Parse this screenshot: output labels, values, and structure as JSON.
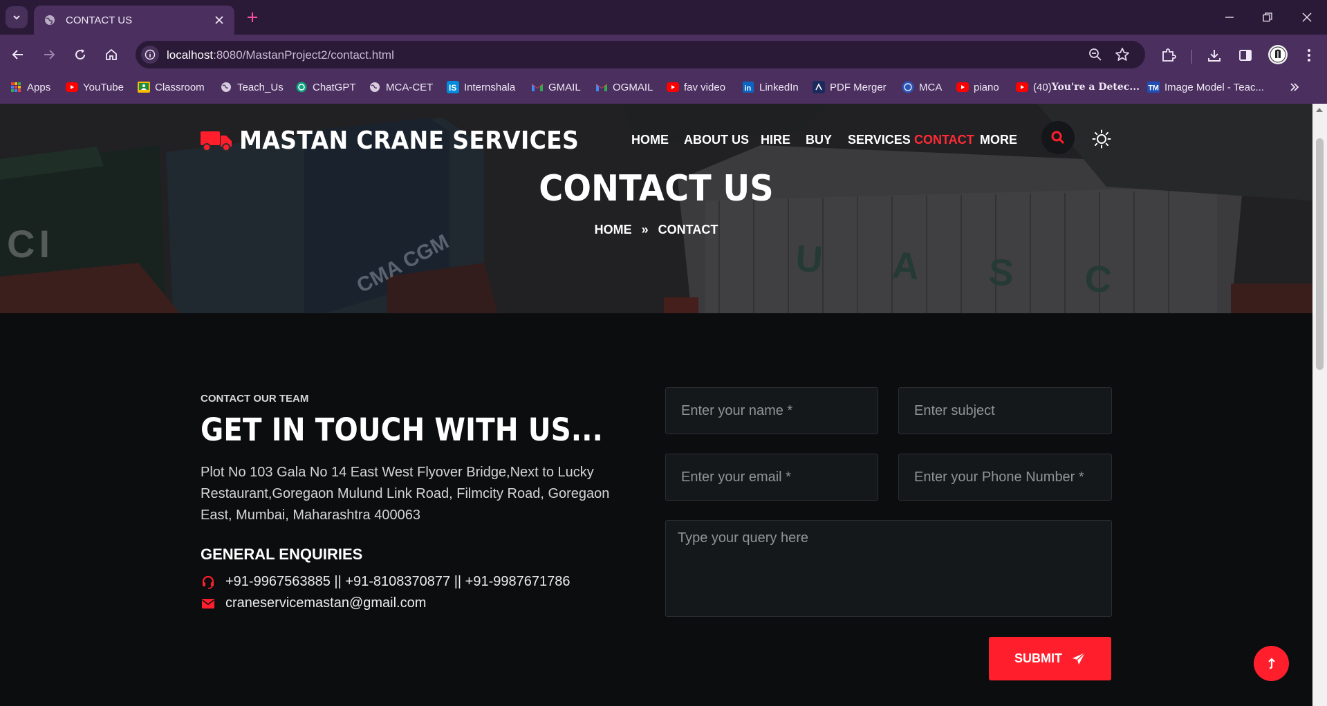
{
  "browser": {
    "tab_title": "CONTACT US",
    "url_host": "localhost",
    "url_rest": ":8080/MastanProject2/contact.html",
    "bookmarks": [
      {
        "label": "Apps",
        "icon": "apps-grid-icon"
      },
      {
        "label": "YouTube",
        "icon": "youtube-icon"
      },
      {
        "label": "Classroom",
        "icon": "classroom-icon"
      },
      {
        "label": "Teach_Us",
        "icon": "globe-icon"
      },
      {
        "label": "ChatGPT",
        "icon": "chatgpt-icon"
      },
      {
        "label": "MCA-CET",
        "icon": "globe-icon"
      },
      {
        "label": "Internshala",
        "icon": "internshala-icon"
      },
      {
        "label": "GMAIL",
        "icon": "gmail-icon"
      },
      {
        "label": "OGMAIL",
        "icon": "gmail-icon"
      },
      {
        "label": "fav video",
        "icon": "youtube-icon"
      },
      {
        "label": "LinkedIn",
        "icon": "linkedin-icon"
      },
      {
        "label": "PDF Merger",
        "icon": "pdf-merger-icon"
      },
      {
        "label": "MCA",
        "icon": "mca-icon"
      },
      {
        "label": "piano",
        "icon": "youtube-icon"
      },
      {
        "label_prefix": "(40) ",
        "label_bold": "You're a Detec...",
        "icon": "youtube-icon"
      },
      {
        "label": "Image Model - Teac...",
        "icon": "tm-icon"
      }
    ]
  },
  "site": {
    "brand": "MASTAN CRANE SERVICES",
    "nav": [
      "HOME",
      "ABOUT US",
      "HIRE",
      "BUY",
      "SERVICES",
      "CONTACT",
      "MORE"
    ],
    "active_nav": "CONTACT",
    "hero_title": "CONTACT US",
    "breadcrumb": {
      "home": "HOME",
      "sep": "»",
      "current": "CONTACT"
    },
    "hero_text": [
      "CI",
      "CMA CGM",
      "U A S C"
    ]
  },
  "contact": {
    "eyebrow": "CONTACT OUR TEAM",
    "title": "GET IN TOUCH WITH US...",
    "address": "Plot No 103 Gala No 14 East West Flyover Bridge,Next to Lucky Restaurant,Goregaon Mulund Link Road, Filmcity Road, Goregaon East, Mumbai, Maharashtra 400063",
    "enquiries_title": "GENERAL ENQUIRIES",
    "phone": "+91-9967563885 || +91-8108370877 || +91-9987671786",
    "email": "craneservicemastan@gmail.com"
  },
  "form": {
    "name_placeholder": "Enter your name *",
    "subject_placeholder": "Enter subject",
    "email_placeholder": "Enter your email *",
    "phone_placeholder": "Enter your Phone Number *",
    "query_placeholder": "Type your query here",
    "submit_label": "SUBMIT"
  },
  "colors": {
    "accent": "#ff1f2c",
    "chrome": "#4a2f5f",
    "page_bg": "#0c0d0f"
  }
}
